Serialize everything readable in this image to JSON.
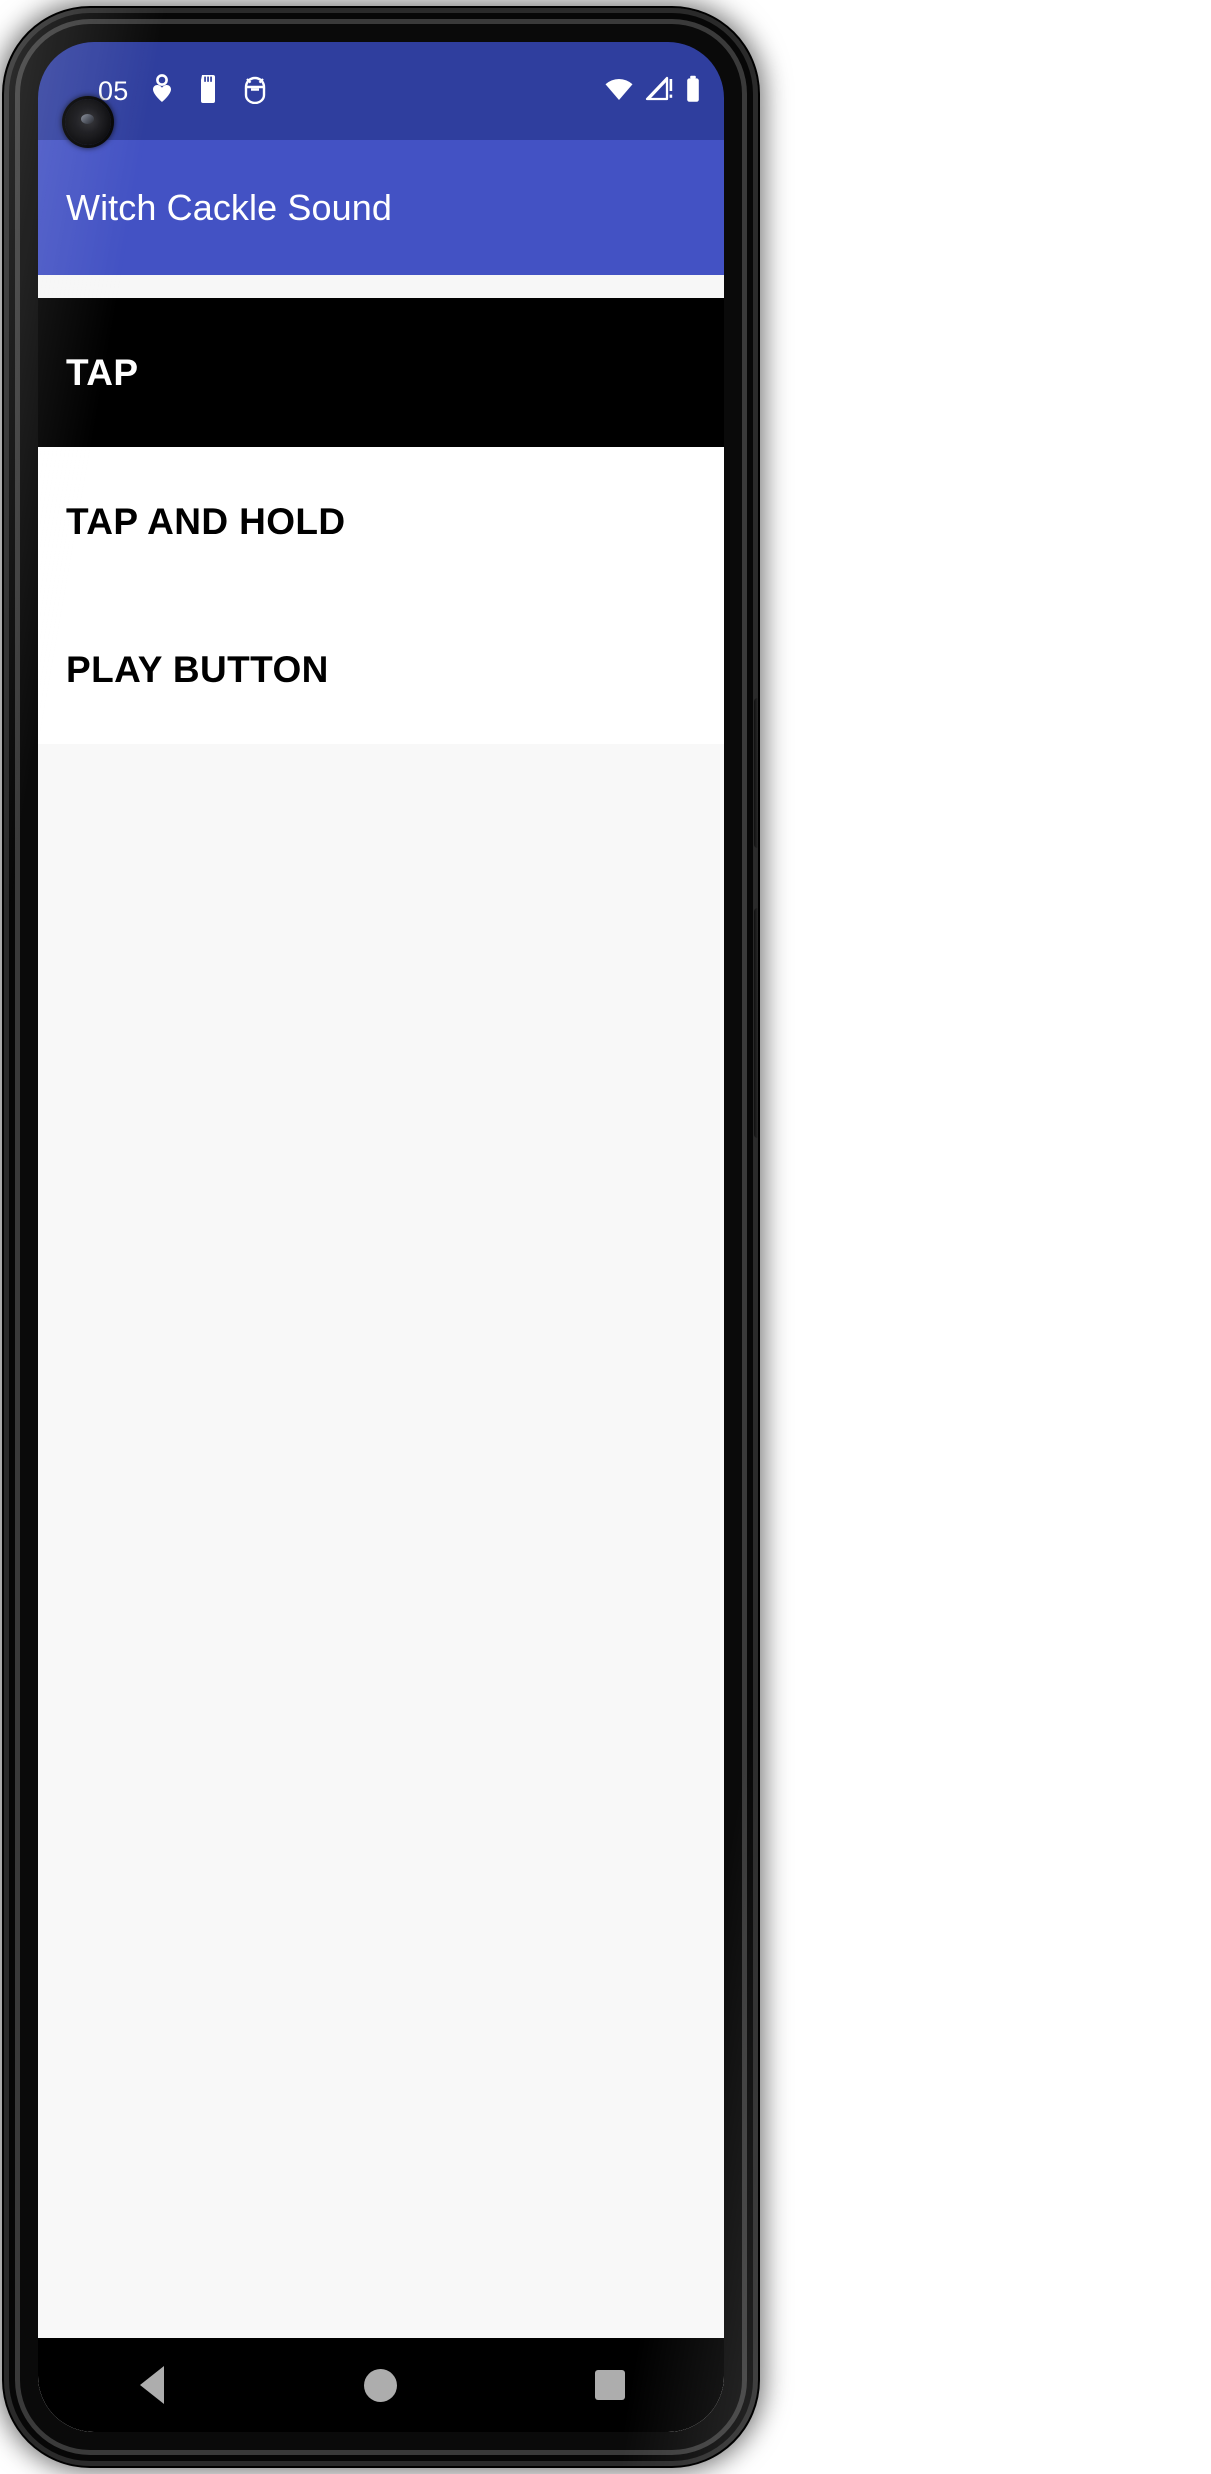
{
  "device": {
    "type": "android-phone-mockup",
    "buttons": [
      "power-button",
      "volume-button"
    ]
  },
  "status_bar": {
    "background_color": "#2F3E9E",
    "clock": "05",
    "left_icons": [
      {
        "name": "camera-punch-hole",
        "glyph": ""
      },
      {
        "name": "heart-location-icon",
        "glyph": ""
      },
      {
        "name": "sd-card-icon",
        "glyph": ""
      },
      {
        "name": "android-debug-icon",
        "glyph": ""
      }
    ],
    "right_icons": [
      {
        "name": "wifi-icon",
        "glyph": ""
      },
      {
        "name": "cellular-signal-icon",
        "glyph": ""
      },
      {
        "name": "battery-icon",
        "glyph": ""
      }
    ]
  },
  "app_bar": {
    "title": "Witch Cackle Sound",
    "background_color": "#4352C4",
    "text_color": "#FFFFFF"
  },
  "content": {
    "background_color": "#F8F8F8",
    "buttons": [
      {
        "label": "TAP",
        "background_color": "#000000",
        "text_color": "#FFFFFF"
      },
      {
        "label": "TAP AND HOLD",
        "background_color": "#FFFFFF",
        "text_color": "#000000"
      },
      {
        "label": "PLAY BUTTON",
        "background_color": "#FFFFFF",
        "text_color": "#000000"
      }
    ]
  },
  "nav_bar": {
    "background_color": "#000000",
    "icon_color": "#ADADAD",
    "items": [
      {
        "name": "back-icon",
        "label": "Back"
      },
      {
        "name": "home-icon",
        "label": "Home"
      },
      {
        "name": "recents-icon",
        "label": "Recents"
      }
    ]
  }
}
